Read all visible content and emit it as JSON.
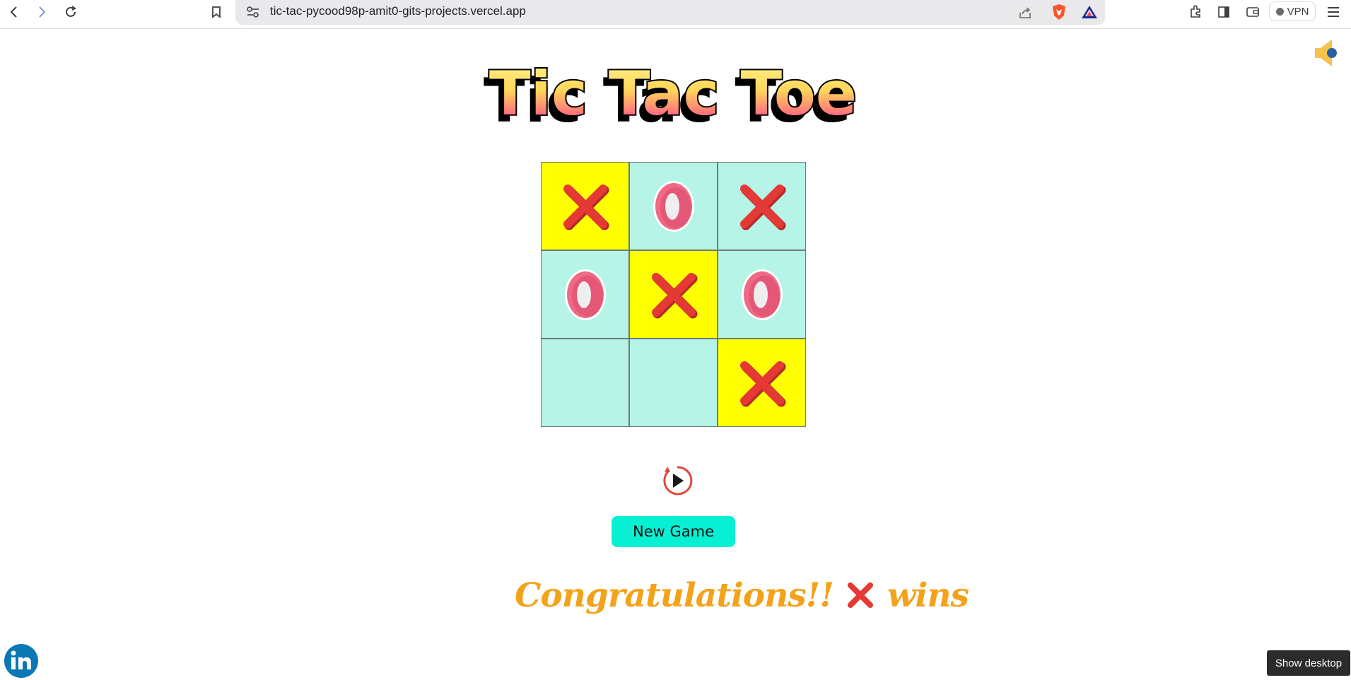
{
  "browser": {
    "url": "tic-tac-pycood98p-amit0-gits-projects.vercel.app",
    "vpn_label": "VPN"
  },
  "page": {
    "title": "Tic Tac Toe",
    "board": [
      {
        "mark": "X",
        "win": true
      },
      {
        "mark": "O",
        "win": false
      },
      {
        "mark": "X",
        "win": false
      },
      {
        "mark": "O",
        "win": false
      },
      {
        "mark": "X",
        "win": true
      },
      {
        "mark": "O",
        "win": false
      },
      {
        "mark": "",
        "win": false
      },
      {
        "mark": "",
        "win": false
      },
      {
        "mark": "X",
        "win": true
      }
    ],
    "new_game_label": "New Game",
    "result_prefix": "Congratulations!!",
    "result_mark": "X",
    "result_suffix": "wins"
  },
  "os": {
    "tooltip": "Show desktop"
  },
  "colors": {
    "cell": "#b5f4e6",
    "win_cell": "#ffff00",
    "x_mark": "#e53935",
    "o_mark": "#f06a85",
    "button": "#08f0d4",
    "result_text": "#f4a21a"
  }
}
